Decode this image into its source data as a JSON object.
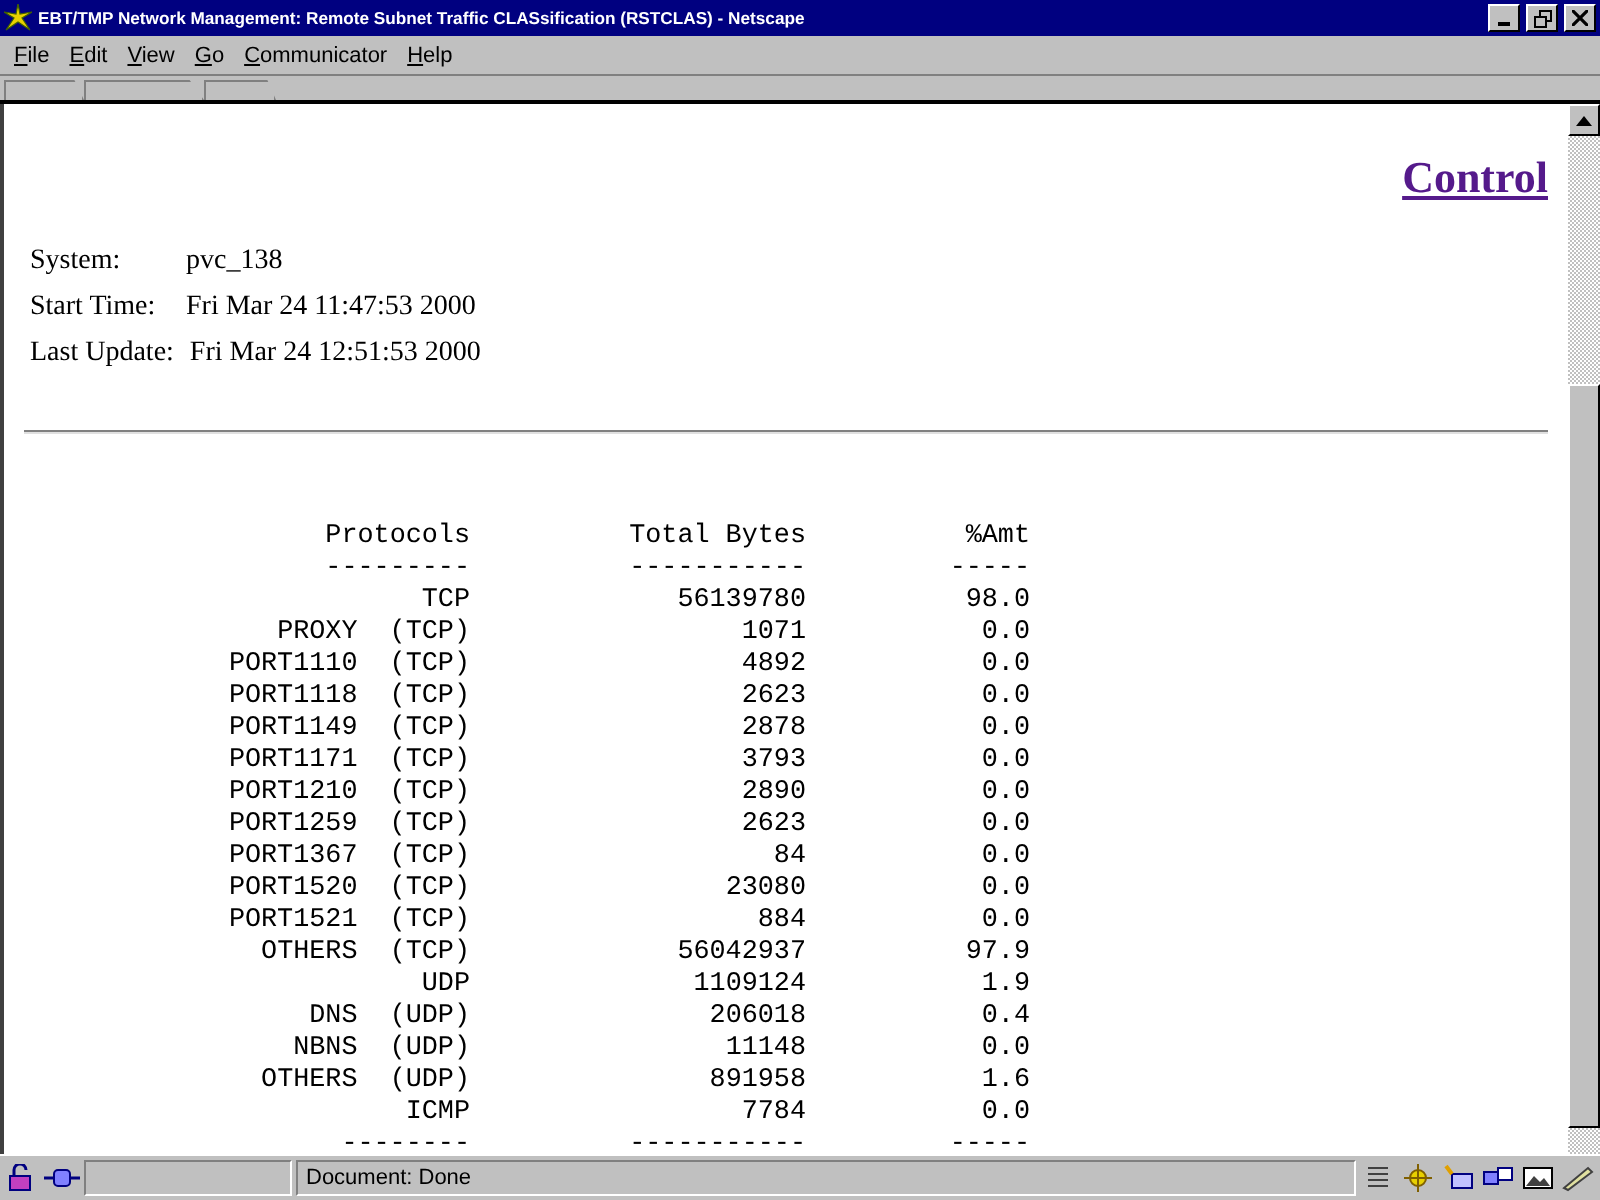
{
  "window": {
    "title": "EBT/TMP Network Management: Remote Subnet Traffic CLASsification (RSTCLAS) - Netscape"
  },
  "menu": [
    "File",
    "Edit",
    "View",
    "Go",
    "Communicator",
    "Help"
  ],
  "page": {
    "link": "Control",
    "info": [
      {
        "label": "System:",
        "value": "pvc_138"
      },
      {
        "label": "Start Time:",
        "value": "Fri Mar 24 11:47:53 2000"
      },
      {
        "label": "Last Update:",
        "value": "Fri Mar 24 12:51:53 2000"
      }
    ],
    "table": {
      "columns": [
        "Protocols",
        "Total Bytes",
        "%Amt"
      ],
      "rules": [
        "---------",
        "-----------",
        "-----"
      ],
      "rows": [
        [
          "TCP",
          "56139780",
          "98.0"
        ],
        [
          "PROXY  (TCP)",
          "1071",
          "0.0"
        ],
        [
          "PORT1110  (TCP)",
          "4892",
          "0.0"
        ],
        [
          "PORT1118  (TCP)",
          "2623",
          "0.0"
        ],
        [
          "PORT1149  (TCP)",
          "2878",
          "0.0"
        ],
        [
          "PORT1171  (TCP)",
          "3793",
          "0.0"
        ],
        [
          "PORT1210  (TCP)",
          "2890",
          "0.0"
        ],
        [
          "PORT1259  (TCP)",
          "2623",
          "0.0"
        ],
        [
          "PORT1367  (TCP)",
          "84",
          "0.0"
        ],
        [
          "PORT1520  (TCP)",
          "23080",
          "0.0"
        ],
        [
          "PORT1521  (TCP)",
          "884",
          "0.0"
        ],
        [
          "OTHERS  (TCP)",
          "56042937",
          "97.9"
        ],
        [
          "UDP",
          "1109124",
          "1.9"
        ],
        [
          "DNS  (UDP)",
          "206018",
          "0.4"
        ],
        [
          "NBNS  (UDP)",
          "11148",
          "0.0"
        ],
        [
          "OTHERS  (UDP)",
          "891958",
          "1.6"
        ],
        [
          "ICMP",
          "7784",
          "0.0"
        ]
      ],
      "footer": [
        "--------",
        "-----------",
        "-----"
      ]
    }
  },
  "status": "Document: Done"
}
